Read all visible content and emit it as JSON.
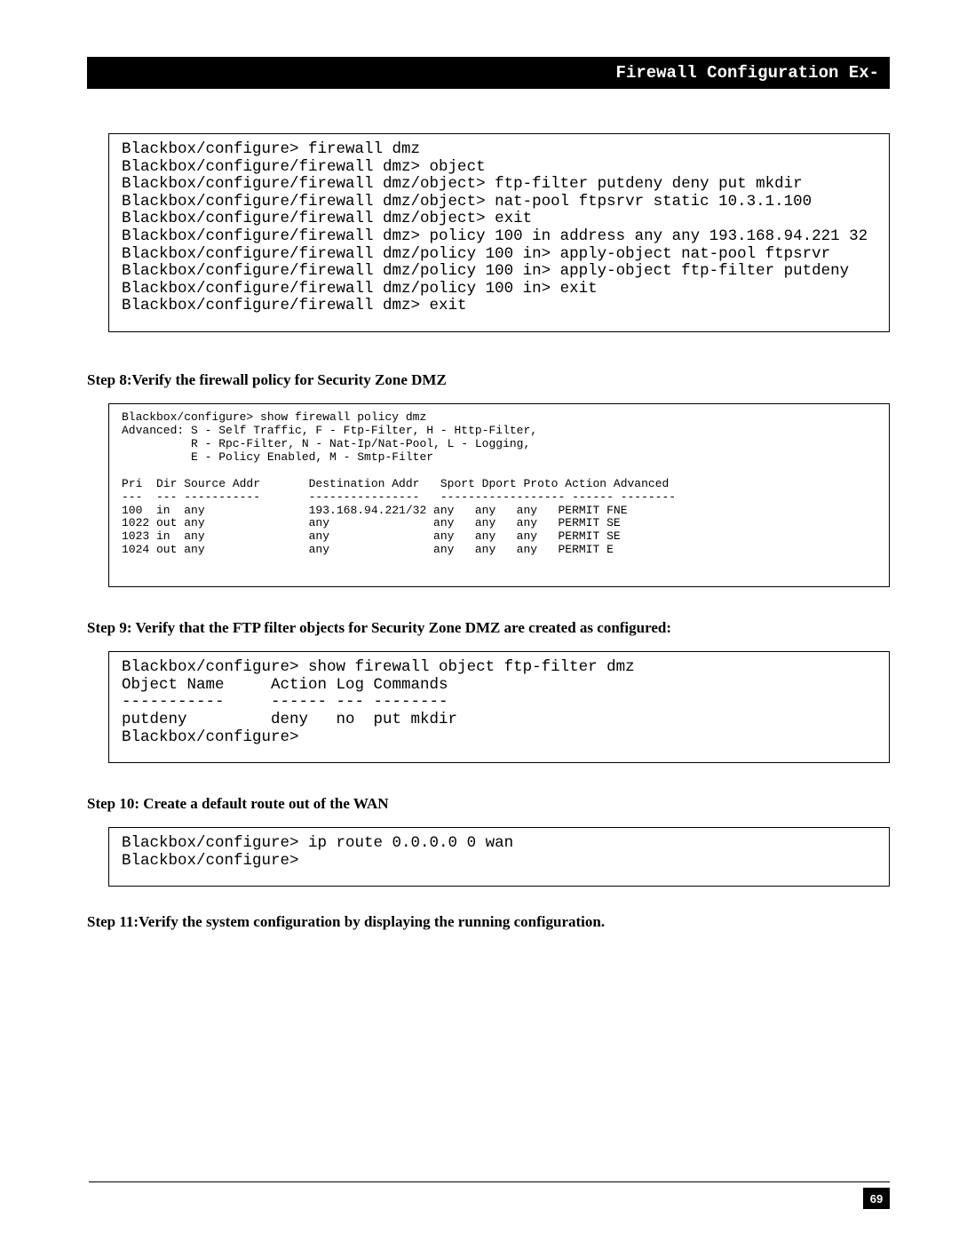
{
  "header": {
    "title": "Firewall Configuration Ex-"
  },
  "code1": "Blackbox/configure> firewall dmz\nBlackbox/configure/firewall dmz> object\nBlackbox/configure/firewall dmz/object> ftp-filter putdeny deny put mkdir\nBlackbox/configure/firewall dmz/object> nat-pool ftpsrvr static 10.3.1.100\nBlackbox/configure/firewall dmz/object> exit\nBlackbox/configure/firewall dmz> policy 100 in address any any 193.168.94.221 32\nBlackbox/configure/firewall dmz/policy 100 in> apply-object nat-pool ftpsrvr\nBlackbox/configure/firewall dmz/policy 100 in> apply-object ftp-filter putdeny\nBlackbox/configure/firewall dmz/policy 100 in> exit\nBlackbox/configure/firewall dmz> exit",
  "step8": {
    "heading": "Step 8:Verify the firewall policy for Security Zone DMZ"
  },
  "code2": "Blackbox/configure> show firewall policy dmz\nAdvanced: S - Self Traffic, F - Ftp-Filter, H - Http-Filter,\n          R - Rpc-Filter, N - Nat-Ip/Nat-Pool, L - Logging,\n          E - Policy Enabled, M - Smtp-Filter\n\nPri  Dir Source Addr       Destination Addr   Sport Dport Proto Action Advanced\n---  --- -----------       ----------------   ------------------ ------ --------\n100  in  any               193.168.94.221/32 any   any   any   PERMIT FNE\n1022 out any               any               any   any   any   PERMIT SE\n1023 in  any               any               any   any   any   PERMIT SE\n1024 out any               any               any   any   any   PERMIT E\n\n",
  "step9": {
    "heading": "Step 9: Verify that the FTP filter objects for Security Zone DMZ are created as configured:"
  },
  "code3": "Blackbox/configure> show firewall object ftp-filter dmz\nObject Name     Action Log Commands\n-----------     ------ --- --------\nputdeny         deny   no  put mkdir\nBlackbox/configure>",
  "step10": {
    "heading": "Step 10: Create a default route out of the WAN"
  },
  "code4": "Blackbox/configure> ip route 0.0.0.0 0 wan\nBlackbox/configure>",
  "step11": {
    "heading": "Step 11:Verify the system configuration by displaying the running configuration."
  },
  "page_number": "69"
}
